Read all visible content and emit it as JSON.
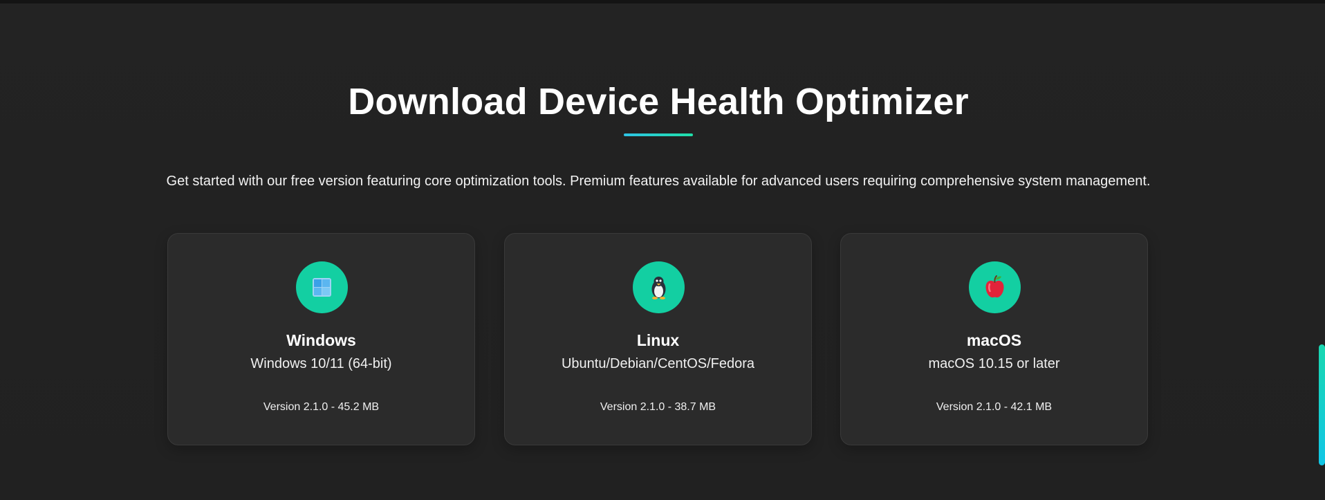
{
  "section": {
    "title": "Download Device Health Optimizer",
    "subtitle": "Get started with our free version featuring core optimization tools. Premium features available for advanced users requiring comprehensive system management.",
    "accent_gradient": [
      "#2ec4e6",
      "#1fe0a8"
    ]
  },
  "downloads": [
    {
      "icon": "windows-logo-icon",
      "name": "Windows",
      "requirements": "Windows 10/11 (64-bit)",
      "version": "Version 2.1.0 - 45.2 MB"
    },
    {
      "icon": "linux-penguin-icon",
      "name": "Linux",
      "requirements": "Ubuntu/Debian/CentOS/Fedora",
      "version": "Version 2.1.0 - 38.7 MB"
    },
    {
      "icon": "apple-icon",
      "name": "macOS",
      "requirements": "macOS 10.15 or later",
      "version": "Version 2.1.0 - 42.1 MB"
    }
  ],
  "colors": {
    "background": "#222222",
    "card": "#2b2b2b",
    "badge": "#13cfa2",
    "scrollbar": "#19d7b0"
  }
}
